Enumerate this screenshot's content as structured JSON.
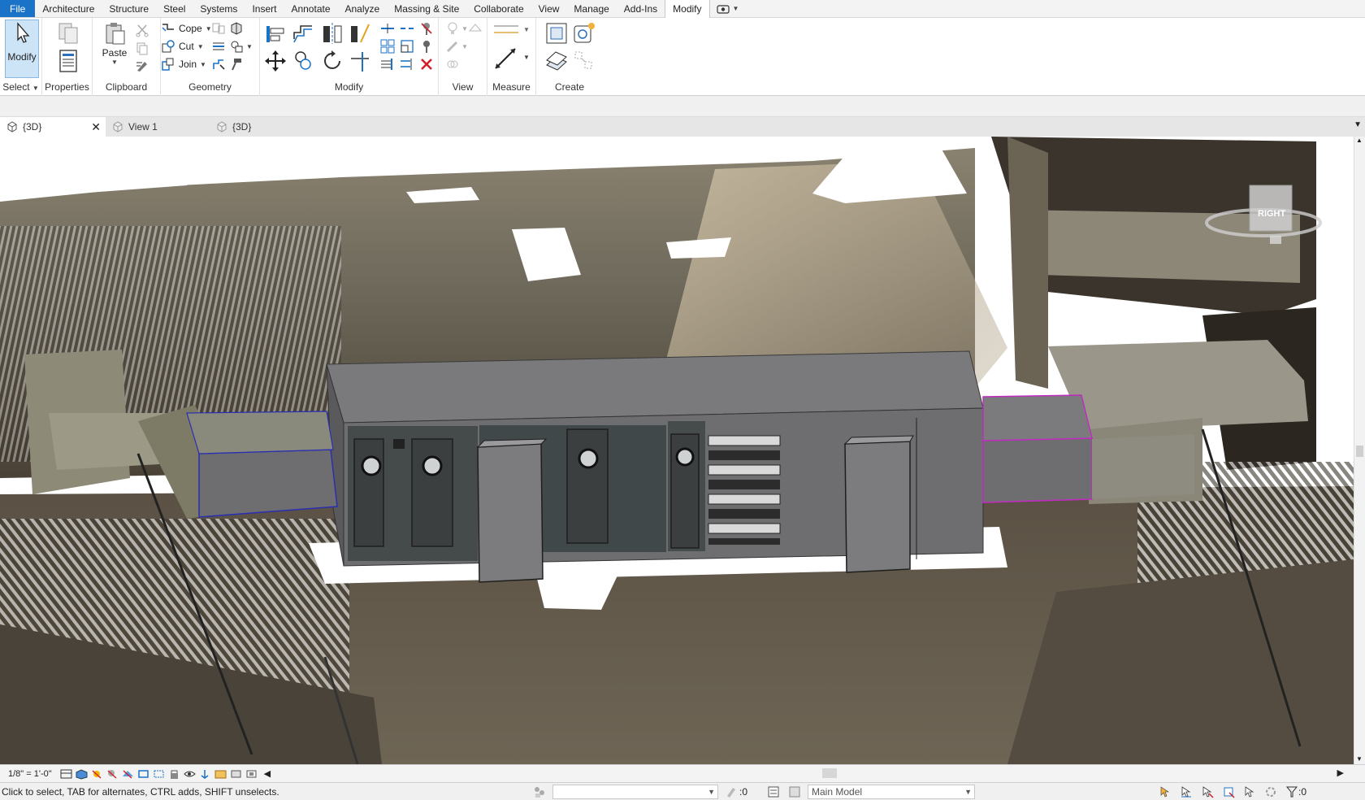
{
  "ribbon_tabs": [
    "File",
    "Architecture",
    "Structure",
    "Steel",
    "Systems",
    "Insert",
    "Annotate",
    "Analyze",
    "Massing & Site",
    "Collaborate",
    "View",
    "Manage",
    "Add-Ins",
    "Modify"
  ],
  "active_tab": "Modify",
  "panels": {
    "select": {
      "button": "Modify",
      "title": "Select"
    },
    "properties": {
      "title": "Properties"
    },
    "clipboard": {
      "button": "Paste",
      "title": "Clipboard"
    },
    "geometry": {
      "cope": "Cope",
      "cut": "Cut",
      "join": "Join",
      "title": "Geometry"
    },
    "modify": {
      "title": "Modify"
    },
    "view": {
      "title": "View"
    },
    "measure": {
      "title": "Measure"
    },
    "create": {
      "title": "Create"
    }
  },
  "view_tabs": [
    {
      "label": "{3D}",
      "active": true
    },
    {
      "label": "View 1",
      "active": false
    },
    {
      "label": "{3D}",
      "active": false
    }
  ],
  "viewcube": {
    "face": "RIGHT"
  },
  "view_control": {
    "scale": "1/8\" = 1'-0\""
  },
  "status_bar": {
    "hint": "Click to select, TAB for alternates, CTRL adds, SHIFT unselects.",
    "workset_value": "",
    "selection_count": ":0",
    "model": "Main Model",
    "filter_count": ":0"
  },
  "colors": {
    "file_tab": "#1b73c8",
    "selected_duct_left": "#2a2fb0",
    "selected_duct_right": "#c02bc0",
    "ahu_body": "#6e6e70",
    "ahu_top": "#7c7c7e"
  },
  "icons": [
    "modify-arrow-icon",
    "properties-icon",
    "paste-icon",
    "cope-icon",
    "cut-icon",
    "join-icon",
    "align-icon",
    "offset-icon",
    "mirror-icon",
    "move-icon",
    "copy-icon",
    "rotate-icon",
    "trim-icon",
    "split-icon",
    "array-icon",
    "scale-icon",
    "pin-icon",
    "delete-icon",
    "measure-icon",
    "create-group-icon",
    "viewcube-icon"
  ]
}
